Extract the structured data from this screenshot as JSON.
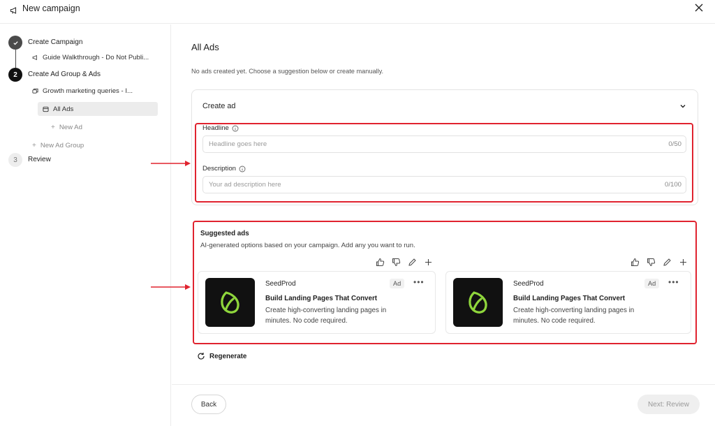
{
  "window": {
    "title": "New campaign",
    "title_icon": "megaphone-icon",
    "close_icon": "close-icon"
  },
  "sidebar": {
    "steps": [
      {
        "badge": "",
        "label": "Create Campaign",
        "state": "done"
      },
      {
        "badge": "2",
        "label": "Create Ad Group & Ads",
        "state": "active"
      },
      {
        "badge": "3",
        "label": "Review",
        "state": "todo"
      }
    ],
    "campaign_item": "Guide Walkthrough - Do Not Publi...",
    "ad_group_item": "Growth marketing queries - I...",
    "all_ads_item": "All Ads",
    "new_ad": "New Ad",
    "new_ad_group": "New Ad Group"
  },
  "main": {
    "title": "All Ads",
    "subtitle": "No ads created yet. Choose a suggestion below or create manually.",
    "create_ad": {
      "header": "Create ad",
      "headline_label": "Headline",
      "headline_placeholder": "Headline goes here",
      "headline_counter": "0/50",
      "description_label": "Description",
      "description_placeholder": "Your ad description here",
      "description_counter": "0/100"
    },
    "suggested": {
      "title": "Suggested ads",
      "subtitle": "AI-generated options based on your campaign. Add any you want to run.",
      "ads": [
        {
          "brand": "SeedProd",
          "tag": "Ad",
          "headline": "Build Landing Pages That Convert",
          "description": "Create high-converting landing pages in minutes. No code required."
        },
        {
          "brand": "SeedProd",
          "tag": "Ad",
          "headline": "Build Landing Pages That Convert",
          "description": "Create high-converting landing pages in minutes. No code required."
        }
      ]
    },
    "regenerate": "Regenerate"
  },
  "footer": {
    "back": "Back",
    "next": "Next: Review"
  },
  "colors": {
    "highlight": "#e0232f",
    "brand_leaf": "#8fd63c"
  }
}
